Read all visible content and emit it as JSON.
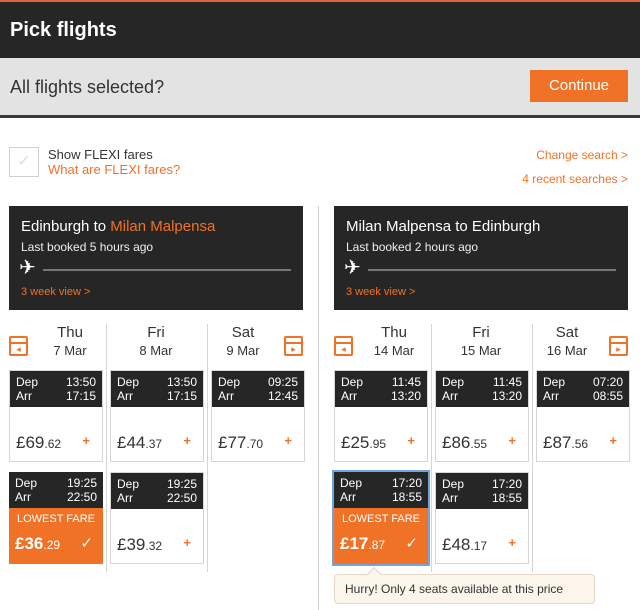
{
  "header": {
    "title": "Pick flights"
  },
  "selection_bar": {
    "question": "All flights selected?",
    "continue_label": "Continue"
  },
  "flexi": {
    "label": "Show FLEXI fares",
    "link": "What are FLEXI fares?",
    "check_glyph": "✓"
  },
  "links": {
    "change_search": "Change search >",
    "recent_searches": "4 recent searches >"
  },
  "outbound": {
    "from": "Edinburgh",
    "to_word": "to",
    "to": "Milan Malpensa",
    "last_booked": "Last booked 5 hours ago",
    "week_view": "3 week view >",
    "days": [
      {
        "name": "Thu",
        "date": "7 Mar"
      },
      {
        "name": "Fri",
        "date": "8 Mar"
      },
      {
        "name": "Sat",
        "date": "9 Mar"
      }
    ],
    "flights": [
      {
        "dep_label": "Dep",
        "arr_label": "Arr",
        "dep": "13:50",
        "arr": "17:15",
        "price": "£69",
        "pence": ".62"
      },
      {
        "dep_label": "Dep",
        "arr_label": "Arr",
        "dep": "13:50",
        "arr": "17:15",
        "price": "£44",
        "pence": ".37"
      },
      {
        "dep_label": "Dep",
        "arr_label": "Arr",
        "dep": "09:25",
        "arr": "12:45",
        "price": "£77",
        "pence": ".70"
      },
      {
        "dep_label": "Dep",
        "arr_label": "Arr",
        "dep": "19:25",
        "arr": "22:50",
        "price": "£36",
        "pence": ".29",
        "badge": "LOWEST FARE"
      },
      {
        "dep_label": "Dep",
        "arr_label": "Arr",
        "dep": "19:25",
        "arr": "22:50",
        "price": "£39",
        "pence": ".32"
      }
    ]
  },
  "return": {
    "title": "Milan Malpensa to Edinburgh",
    "last_booked": "Last booked 2 hours ago",
    "week_view": "3 week view >",
    "days": [
      {
        "name": "Thu",
        "date": "14 Mar"
      },
      {
        "name": "Fri",
        "date": "15 Mar"
      },
      {
        "name": "Sat",
        "date": "16 Mar"
      }
    ],
    "flights": [
      {
        "dep_label": "Dep",
        "arr_label": "Arr",
        "dep": "11:45",
        "arr": "13:20",
        "price": "£25",
        "pence": ".95"
      },
      {
        "dep_label": "Dep",
        "arr_label": "Arr",
        "dep": "11:45",
        "arr": "13:20",
        "price": "£86",
        "pence": ".55"
      },
      {
        "dep_label": "Dep",
        "arr_label": "Arr",
        "dep": "07:20",
        "arr": "08:55",
        "price": "£87",
        "pence": ".56"
      },
      {
        "dep_label": "Dep",
        "arr_label": "Arr",
        "dep": "17:20",
        "arr": "18:55",
        "price": "£17",
        "pence": ".87",
        "badge": "LOWEST FARE"
      },
      {
        "dep_label": "Dep",
        "arr_label": "Arr",
        "dep": "17:20",
        "arr": "18:55",
        "price": "£48",
        "pence": ".17"
      }
    ]
  },
  "tooltip": {
    "text": "Hurry! Only 4 seats available at this price"
  },
  "glyphs": {
    "plane": "✈",
    "add": "+",
    "tick": "✓",
    "cal_prev": "◂",
    "cal_next": "▸"
  },
  "icons": [
    "plane-icon",
    "calendar-icon",
    "checkbox-icon",
    "plus-icon",
    "checkmark-icon"
  ],
  "colors": {
    "accent": "#f07227",
    "dark": "#262626",
    "selected_outline": "#6fa4dc",
    "bar": "#e3e3e3"
  }
}
